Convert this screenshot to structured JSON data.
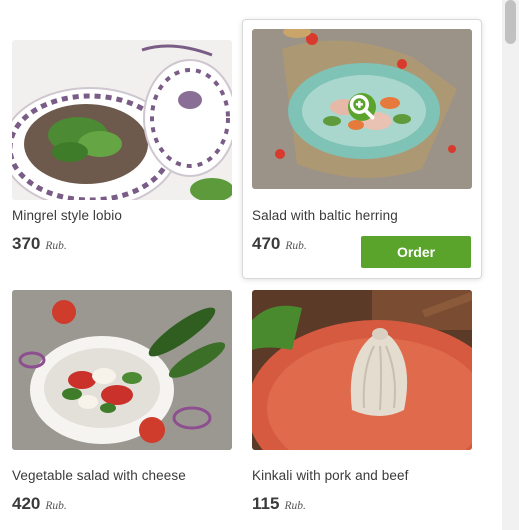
{
  "products": [
    {
      "title": "Mingrel style lobio",
      "price": "370",
      "currency": "Rub."
    },
    {
      "title": "Salad with baltic herring",
      "price": "470",
      "currency": "Rub.",
      "order_label": "Order"
    },
    {
      "title": "Vegetable salad with cheese",
      "price": "420",
      "currency": "Rub."
    },
    {
      "title": "Kinkali with pork and beef",
      "price": "115",
      "currency": "Rub."
    }
  ],
  "colors": {
    "accent": "#5aa42c",
    "text": "#3a3a3a"
  },
  "icons": {
    "zoom": "zoom-in-icon"
  }
}
